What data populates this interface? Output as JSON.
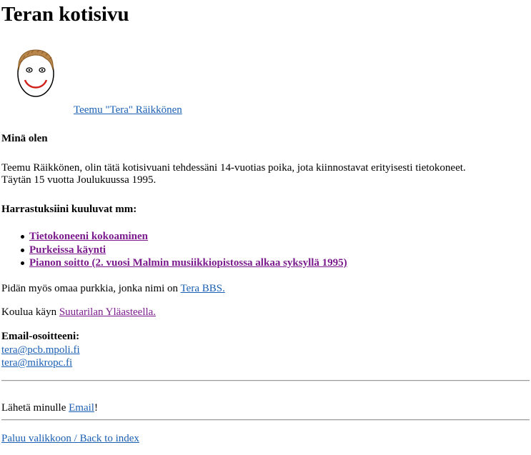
{
  "page": {
    "title": "Teran kotisivu"
  },
  "profile": {
    "avatar_icon": "smiley-face-drawing",
    "name_link": "Teemu \"Tera\" Räikkönen"
  },
  "about": {
    "heading": "Minä olen",
    "line1": "Teemu Räikkönen, olin tätä kotisivuani tehdessäni 14-vuotias poika, jota kiinnostavat erityisesti tietokoneet.",
    "line2": "Täytän 15 vuotta Joulukuussa 1995."
  },
  "hobbies": {
    "heading": "Harrastuksiini kuuluvat mm:",
    "items": [
      "Tietokoneeni kokoaminen",
      "Purkeissa käynti",
      "Pianon soitto (2. vuosi Malmin musiikkiopistossa alkaa syksyllä 1995)"
    ]
  },
  "bbs": {
    "text": "Pidän myös omaa purkkia, jonka nimi on ",
    "link": "Tera BBS."
  },
  "school": {
    "text": "Koulua käyn ",
    "link": "Suutarilan Yläasteella."
  },
  "email": {
    "heading": "Email-osoitteeni:",
    "addresses": [
      "tera@pcb.mpoli.fi",
      "tera@mikropc.fi"
    ]
  },
  "send": {
    "text_before": "Lähetä minulle ",
    "link": "Email",
    "text_after": "!"
  },
  "footer": {
    "back_link": "Paluu valikkoon / Back to index"
  },
  "colors": {
    "link": "#1a5fb4",
    "visited_link": "#7a1a8c"
  }
}
